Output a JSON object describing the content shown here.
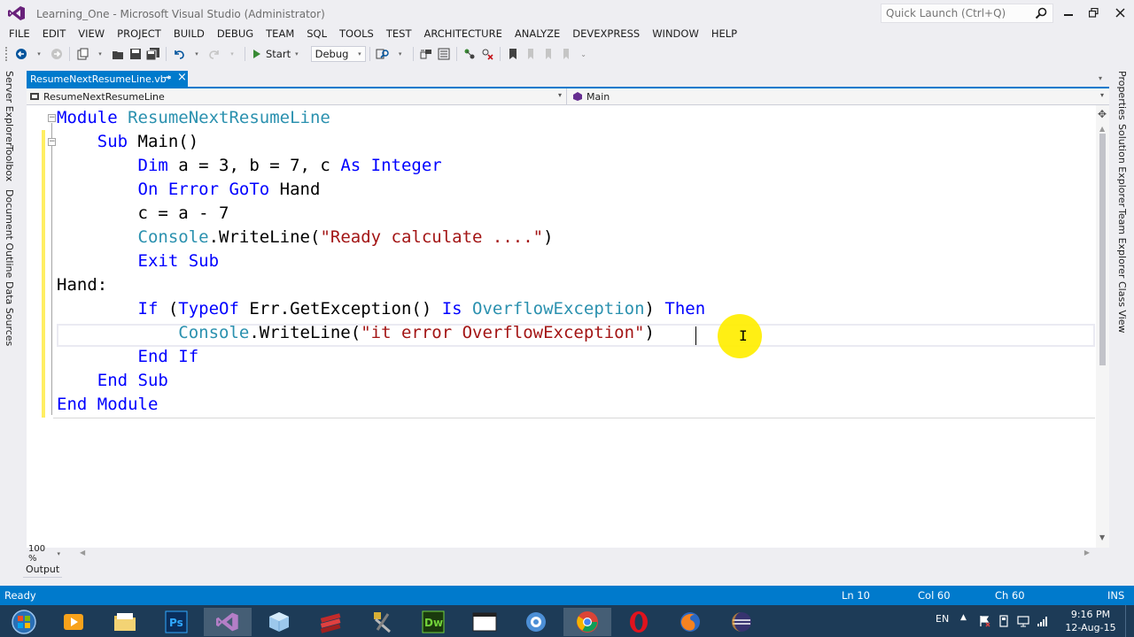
{
  "window": {
    "title": "Learning_One - Microsoft Visual Studio (Administrator)",
    "quick_launch_placeholder": "Quick Launch (Ctrl+Q)"
  },
  "menu": [
    "FILE",
    "EDIT",
    "VIEW",
    "PROJECT",
    "BUILD",
    "DEBUG",
    "TEAM",
    "SQL",
    "TOOLS",
    "TEST",
    "ARCHITECTURE",
    "ANALYZE",
    "DEVEXPRESS",
    "WINDOW",
    "HELP"
  ],
  "toolbar": {
    "start_label": "Start",
    "configuration": "Debug"
  },
  "left_tabs": [
    "Server Explorer",
    "Toolbox",
    "Document Outline",
    "Data Sources"
  ],
  "right_tabs": [
    "Properties",
    "Solution Explorer",
    "Team Explorer",
    "Class View"
  ],
  "document_tab": {
    "label": "ResumeNextResumeLine.vb*"
  },
  "navbar": {
    "left": "ResumeNextResumeLine",
    "right": "Main"
  },
  "code": {
    "l1": {
      "a": "Module ",
      "b": "ResumeNextResumeLine"
    },
    "l2": {
      "a": "    Sub ",
      "b": "Main()"
    },
    "l3": {
      "a": "        Dim ",
      "b": "a = 3, b = 7, c ",
      "c": "As Integer"
    },
    "l4": {
      "a": "        On Error GoTo ",
      "b": "Hand"
    },
    "l5": {
      "a": "        c = a - 7"
    },
    "l6": {
      "a": "        ",
      "b": "Console",
      "c": ".WriteLine(",
      "d": "\"Ready calculate ....\"",
      "e": ")"
    },
    "l7": {
      "a": "        Exit Sub"
    },
    "l8": {
      "a": "Hand:"
    },
    "l9": {
      "a": "        If ",
      "b": "(",
      "c": "TypeOf ",
      "d": "Err.GetException() ",
      "e": "Is ",
      "f": "OverflowException",
      "g": ") ",
      "h": "Then"
    },
    "l10": {
      "a": "            ",
      "b": "Console",
      "c": ".WriteLine(",
      "d": "\"it error OverflowException\"",
      "e": ")"
    },
    "l11": {
      "a": "        End If"
    },
    "l12": {
      "a": "    End Sub"
    },
    "l13": {
      "a": "End Module"
    }
  },
  "zoom": "100 %",
  "output_tab": "Output",
  "status": {
    "state": "Ready",
    "line": "Ln 10",
    "col": "Col 60",
    "ch": "Ch 60",
    "mode": "INS"
  },
  "taskbar": {
    "lang": "EN",
    "time": "9:16 PM",
    "date": "12-Aug-15",
    "apps": [
      "start-orb-icon",
      "media-player-icon",
      "file-explorer-icon",
      "photoshop-icon",
      "visual-studio-icon",
      "box-app-icon",
      "rar-icon",
      "tools-icon",
      "dreamweaver-icon",
      "window-app-icon",
      "network-icon",
      "chrome-icon",
      "opera-icon",
      "firefox-icon",
      "eclipse-icon"
    ]
  },
  "colors": {
    "accent": "#007acc",
    "keyword": "#0000ff",
    "type": "#2b91af",
    "string": "#a31515",
    "taskbar": "#1d3b57"
  }
}
